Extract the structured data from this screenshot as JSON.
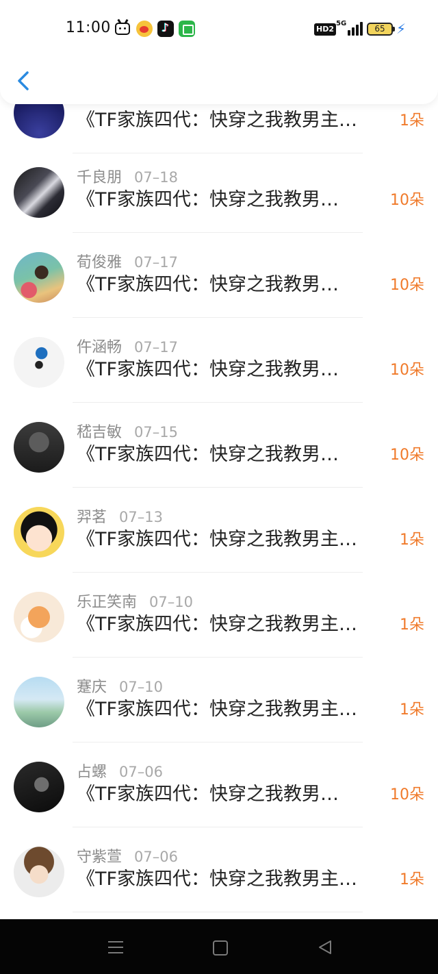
{
  "status_bar": {
    "time": "11:00",
    "network_badge": "HD2",
    "network_type": "5G",
    "battery": "65",
    "apps": [
      "bilibili-icon",
      "weibo-icon",
      "douyin-icon",
      "messages-icon"
    ]
  },
  "colors": {
    "accent_back": "#2a8ae0",
    "gift_orange": "#f07a2a",
    "meta_gray": "#8c8c8c",
    "title_text": "#222222"
  },
  "list": [
    {
      "name": "",
      "date": "",
      "title": "《TF家族四代：快穿之我教男主…",
      "gift": "1朵"
    },
    {
      "name": "千良朋",
      "date": "07–18",
      "title": "《TF家族四代：快穿之我教男…",
      "gift": "10朵"
    },
    {
      "name": "荀俊雅",
      "date": "07–17",
      "title": "《TF家族四代：快穿之我教男…",
      "gift": "10朵"
    },
    {
      "name": "仵涵畅",
      "date": "07–17",
      "title": "《TF家族四代：快穿之我教男…",
      "gift": "10朵"
    },
    {
      "name": "嵇吉敏",
      "date": "07–15",
      "title": "《TF家族四代：快穿之我教男…",
      "gift": "10朵"
    },
    {
      "name": "羿茗",
      "date": "07–13",
      "title": "《TF家族四代：快穿之我教男主…",
      "gift": "1朵"
    },
    {
      "name": "乐正笑南",
      "date": "07–10",
      "title": "《TF家族四代：快穿之我教男主…",
      "gift": "1朵"
    },
    {
      "name": "蹇庆",
      "date": "07–10",
      "title": "《TF家族四代：快穿之我教男主…",
      "gift": "1朵"
    },
    {
      "name": "占螺",
      "date": "07–06",
      "title": "《TF家族四代：快穿之我教男…",
      "gift": "10朵"
    },
    {
      "name": "守紫萱",
      "date": "07–06",
      "title": "《TF家族四代：快穿之我教男主…",
      "gift": "1朵"
    }
  ]
}
